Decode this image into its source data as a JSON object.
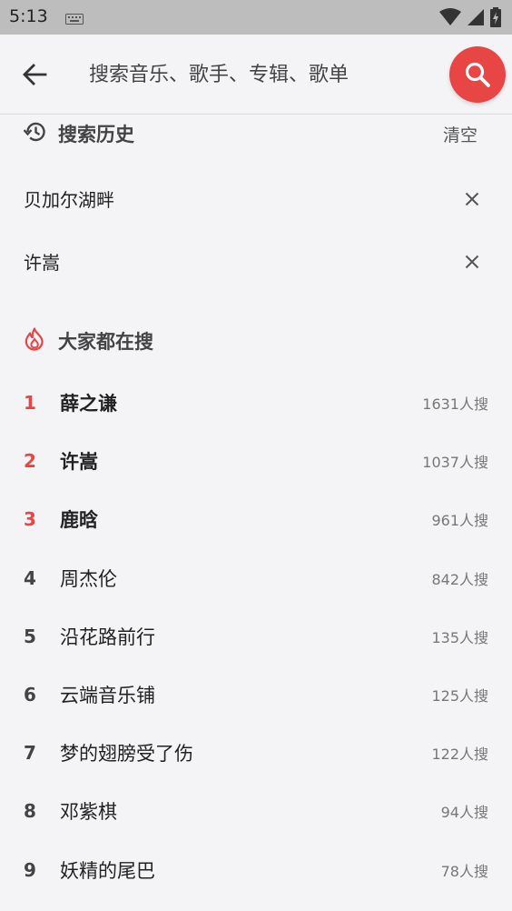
{
  "status_bar": {
    "time": "5:13"
  },
  "search": {
    "placeholder": "搜索音乐、歌手、专辑、歌单",
    "value": ""
  },
  "history": {
    "title": "搜索历史",
    "clear_label": "清空",
    "items": [
      {
        "text": "贝加尔湖畔"
      },
      {
        "text": "许嵩"
      }
    ]
  },
  "hot": {
    "title": "大家都在搜",
    "items": [
      {
        "rank": "1",
        "name": "薛之谦",
        "count": "1631人搜"
      },
      {
        "rank": "2",
        "name": "许嵩",
        "count": "1037人搜"
      },
      {
        "rank": "3",
        "name": "鹿晗",
        "count": "961人搜"
      },
      {
        "rank": "4",
        "name": "周杰伦",
        "count": "842人搜"
      },
      {
        "rank": "5",
        "name": "沿花路前行",
        "count": "135人搜"
      },
      {
        "rank": "6",
        "name": "云端音乐铺",
        "count": "125人搜"
      },
      {
        "rank": "7",
        "name": "梦的翅膀受了伤",
        "count": "122人搜"
      },
      {
        "rank": "8",
        "name": "邓紫棋",
        "count": "94人搜"
      },
      {
        "rank": "9",
        "name": "妖精的尾巴",
        "count": "78人搜"
      }
    ]
  },
  "colors": {
    "accent": "#e84545",
    "background": "#f4f3f6",
    "status_bar": "#bdbdbd"
  }
}
